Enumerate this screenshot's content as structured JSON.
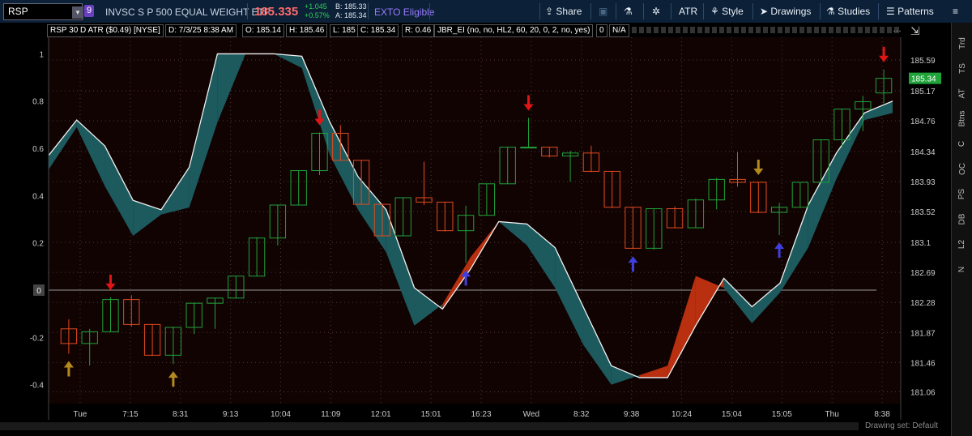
{
  "toolbar": {
    "symbol": "RSP",
    "badge": "9",
    "description": "INVSC S P 500 EQUAL WEIGHT ETF",
    "last": "185.335",
    "net_change": "+1.045",
    "pct_change": "+0.57%",
    "bid": "B: 185.33",
    "ask": "A: 185.34",
    "flag": "EXTO Eligible",
    "share": "Share",
    "atr": "ATR",
    "style": "Style",
    "drawings": "Drawings",
    "studies": "Studies",
    "patterns": "Patterns",
    "colors": {
      "last": "#ff6b6b",
      "change": "#2fd05a",
      "flag": "#9a7cff",
      "bar": "#0c2037"
    }
  },
  "infobar": {
    "title": "RSP 30 D ATR ($0.49) [NYSE]",
    "date": "D: 7/3/25 8:38 AM",
    "open": "O: 185.14",
    "high": "H: 185.46",
    "low": "L: 185",
    "close": "C: 185.34",
    "range": "R: 0.46",
    "study": "JBR_EI (no, no, HL2, 60, 20, 0, 2, no, yes)",
    "study_value": "0",
    "na": "N/A"
  },
  "right_tabs": [
    "Trd",
    "TS",
    "AT",
    "Btns",
    "C",
    "OC",
    "PS",
    "DB",
    "L2",
    "N"
  ],
  "drawing_set": "Drawing set: Default",
  "chart_data": {
    "type": "candlestick",
    "x_ticks": [
      "Tue",
      "7:15",
      "8:31",
      "9:13",
      "10:04",
      "11:09",
      "12:01",
      "15:01",
      "16:23",
      "Wed",
      "8:32",
      "9:38",
      "10:24",
      "15:04",
      "15:05",
      "Thu",
      "8:38"
    ],
    "price_axis": {
      "ticks": [
        "185.59",
        "185.17",
        "184.76",
        "184.34",
        "183.93",
        "183.52",
        "183.1",
        "182.69",
        "182.28",
        "181.87",
        "181.46",
        "181.06"
      ],
      "last_price_label": "185.34",
      "last_price_color": "#1fa33a"
    },
    "oscillator_axis": {
      "ticks": [
        "1",
        "0.8",
        "0.6",
        "0.4",
        "0.2",
        "0",
        "-0.2",
        "-0.4"
      ],
      "range": [
        -0.48,
        1.07
      ],
      "zero_line": 0
    },
    "price_range": [
      180.9,
      185.9
    ],
    "candles": [
      {
        "o": 181.92,
        "h": 182.05,
        "l": 181.58,
        "c": 181.72
      },
      {
        "o": 181.72,
        "h": 181.92,
        "l": 181.42,
        "c": 181.88
      },
      {
        "o": 181.88,
        "h": 182.35,
        "l": 181.88,
        "c": 182.32
      },
      {
        "o": 182.32,
        "h": 182.38,
        "l": 181.95,
        "c": 181.98
      },
      {
        "o": 181.98,
        "h": 181.98,
        "l": 181.55,
        "c": 181.56
      },
      {
        "o": 181.56,
        "h": 181.95,
        "l": 181.44,
        "c": 181.94
      },
      {
        "o": 181.94,
        "h": 182.27,
        "l": 181.85,
        "c": 182.27
      },
      {
        "o": 182.27,
        "h": 182.34,
        "l": 181.92,
        "c": 182.34
      },
      {
        "o": 182.34,
        "h": 182.64,
        "l": 182.34,
        "c": 182.64
      },
      {
        "o": 182.64,
        "h": 183.17,
        "l": 182.64,
        "c": 183.16
      },
      {
        "o": 183.16,
        "h": 183.61,
        "l": 183.06,
        "c": 183.61
      },
      {
        "o": 183.61,
        "h": 184.08,
        "l": 183.61,
        "c": 184.08
      },
      {
        "o": 184.08,
        "h": 184.6,
        "l": 184.02,
        "c": 184.59
      },
      {
        "o": 184.59,
        "h": 184.7,
        "l": 184.22,
        "c": 184.22
      },
      {
        "o": 184.22,
        "h": 184.22,
        "l": 183.62,
        "c": 183.62
      },
      {
        "o": 183.62,
        "h": 183.62,
        "l": 183.19,
        "c": 183.19
      },
      {
        "o": 183.19,
        "h": 183.71,
        "l": 183.19,
        "c": 183.71
      },
      {
        "o": 183.71,
        "h": 184.2,
        "l": 183.61,
        "c": 183.65
      },
      {
        "o": 183.65,
        "h": 183.65,
        "l": 183.25,
        "c": 183.26
      },
      {
        "o": 183.26,
        "h": 183.6,
        "l": 182.82,
        "c": 183.47
      },
      {
        "o": 183.47,
        "h": 183.9,
        "l": 183.47,
        "c": 183.9
      },
      {
        "o": 183.9,
        "h": 184.4,
        "l": 183.9,
        "c": 184.4
      },
      {
        "o": 184.4,
        "h": 184.8,
        "l": 184.4,
        "c": 184.4
      },
      {
        "o": 184.4,
        "h": 184.4,
        "l": 184.26,
        "c": 184.28
      },
      {
        "o": 184.28,
        "h": 184.35,
        "l": 183.93,
        "c": 184.32
      },
      {
        "o": 184.32,
        "h": 184.42,
        "l": 184.06,
        "c": 184.07
      },
      {
        "o": 184.07,
        "h": 184.07,
        "l": 183.57,
        "c": 183.58
      },
      {
        "o": 183.58,
        "h": 183.58,
        "l": 183.01,
        "c": 183.02
      },
      {
        "o": 183.02,
        "h": 183.56,
        "l": 183.0,
        "c": 183.56
      },
      {
        "o": 183.56,
        "h": 183.59,
        "l": 183.3,
        "c": 183.3
      },
      {
        "o": 183.3,
        "h": 183.7,
        "l": 183.3,
        "c": 183.68
      },
      {
        "o": 183.68,
        "h": 183.98,
        "l": 183.55,
        "c": 183.96
      },
      {
        "o": 183.96,
        "h": 184.33,
        "l": 183.86,
        "c": 183.92
      },
      {
        "o": 183.92,
        "h": 183.92,
        "l": 183.5,
        "c": 183.51
      },
      {
        "o": 183.51,
        "h": 183.64,
        "l": 183.2,
        "c": 183.58
      },
      {
        "o": 183.58,
        "h": 183.92,
        "l": 183.58,
        "c": 183.92
      },
      {
        "o": 183.92,
        "h": 184.5,
        "l": 183.92,
        "c": 184.5
      },
      {
        "o": 184.5,
        "h": 184.92,
        "l": 184.4,
        "c": 184.92
      },
      {
        "o": 184.92,
        "h": 185.1,
        "l": 184.62,
        "c": 185.02
      },
      {
        "o": 185.14,
        "h": 185.46,
        "l": 185.0,
        "c": 185.34
      }
    ],
    "band_upper": [
      0.57,
      0.72,
      0.61,
      0.38,
      0.34,
      0.52,
      1.0,
      1.0,
      1.0,
      0.99,
      0.71,
      0.48,
      0.34,
      0.01,
      -0.08,
      0.09,
      0.29,
      0.28,
      0.18,
      -0.07,
      -0.32,
      -0.37,
      -0.37,
      -0.15,
      0.05,
      -0.07,
      0.03,
      0.36,
      0.58,
      0.75,
      0.8
    ],
    "band_lower": [
      0.51,
      0.69,
      0.44,
      0.23,
      0.32,
      0.35,
      0.71,
      1.0,
      1.0,
      0.94,
      0.57,
      0.34,
      0.16,
      -0.15,
      -0.06,
      0.14,
      0.29,
      0.19,
      0.01,
      -0.23,
      -0.4,
      -0.36,
      -0.32,
      0.06,
      0.01,
      -0.14,
      -0.01,
      0.18,
      0.47,
      0.72,
      0.75
    ],
    "band_bull_color": "#1c5a5e",
    "band_bear_color": "#b8300f",
    "arrows": [
      {
        "bar": 0,
        "dir": "up",
        "color": "#b38a1e"
      },
      {
        "bar": 2,
        "dir": "down",
        "color": "#e01515"
      },
      {
        "bar": 5,
        "dir": "up",
        "color": "#b38a1e"
      },
      {
        "bar": 12,
        "dir": "down",
        "color": "#e01515"
      },
      {
        "bar": 19,
        "dir": "up",
        "color": "#3f3fe0"
      },
      {
        "bar": 22,
        "dir": "down",
        "color": "#e01515"
      },
      {
        "bar": 27,
        "dir": "up",
        "color": "#3f3fe0"
      },
      {
        "bar": 33,
        "dir": "down",
        "color": "#b38a1e"
      },
      {
        "bar": 34,
        "dir": "up",
        "color": "#3f3fe0"
      },
      {
        "bar": 39,
        "dir": "down",
        "color": "#e01515"
      }
    ],
    "up_color": "#1fa33a",
    "down_color": "#e04a1f",
    "grid": true
  }
}
